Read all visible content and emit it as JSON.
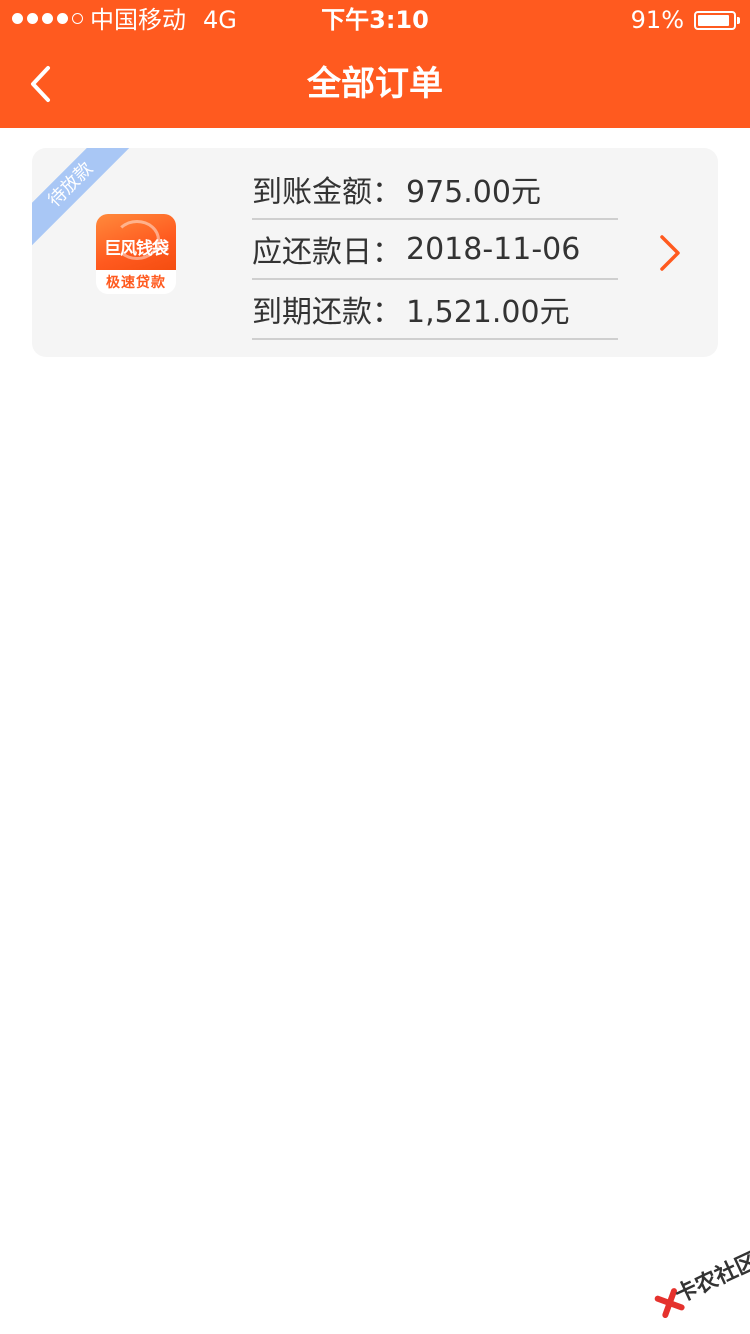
{
  "status_bar": {
    "signal_bars": 5,
    "signal_filled": 4,
    "carrier": "中国移动",
    "network": "4G",
    "time": "下午3:10",
    "battery_percent_text": "91%",
    "battery_level": 0.91
  },
  "nav": {
    "title": "全部订单",
    "back_icon": "chevron-left-icon"
  },
  "orders": [
    {
      "status_badge": "待放款",
      "app_logo": {
        "name": "巨风钱袋",
        "tagline": "极速贷款"
      },
      "fields": [
        {
          "label": "到账金额：",
          "value": "975.00元"
        },
        {
          "label": "应还款日：",
          "value": "2018-11-06"
        },
        {
          "label": "到期还款：",
          "value": "1,521.00元"
        }
      ],
      "detail_icon": "chevron-right-icon"
    }
  ],
  "watermark": {
    "text": "卡农社区"
  },
  "colors": {
    "brand": "#ff5a1f",
    "badge": "#a9c7f5",
    "card_bg": "#f5f5f5",
    "text": "#333333"
  }
}
